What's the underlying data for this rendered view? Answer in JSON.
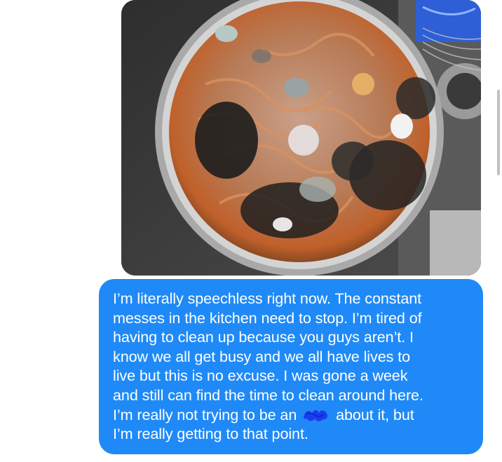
{
  "message": {
    "lines": [
      "I’m literally speechless right now. The constant",
      "messes in the kitchen need to stop. I’m tired of",
      "having to clean up because you guys aren’t. I",
      "know we all get busy and we all have lives to",
      "live but this is no excuse. I was gone a week",
      "and still can find the time to clean around here.",
      "I’m really not trying to be an",
      "about it, but",
      "I’m really getting to that point."
    ]
  },
  "colors": {
    "bubble": "#1f8af7",
    "bubble_text": "#ffffff",
    "redaction": "#1a3cf0",
    "background": "#ffffff"
  },
  "icons": {
    "redaction": "scribble-redaction-icon"
  }
}
